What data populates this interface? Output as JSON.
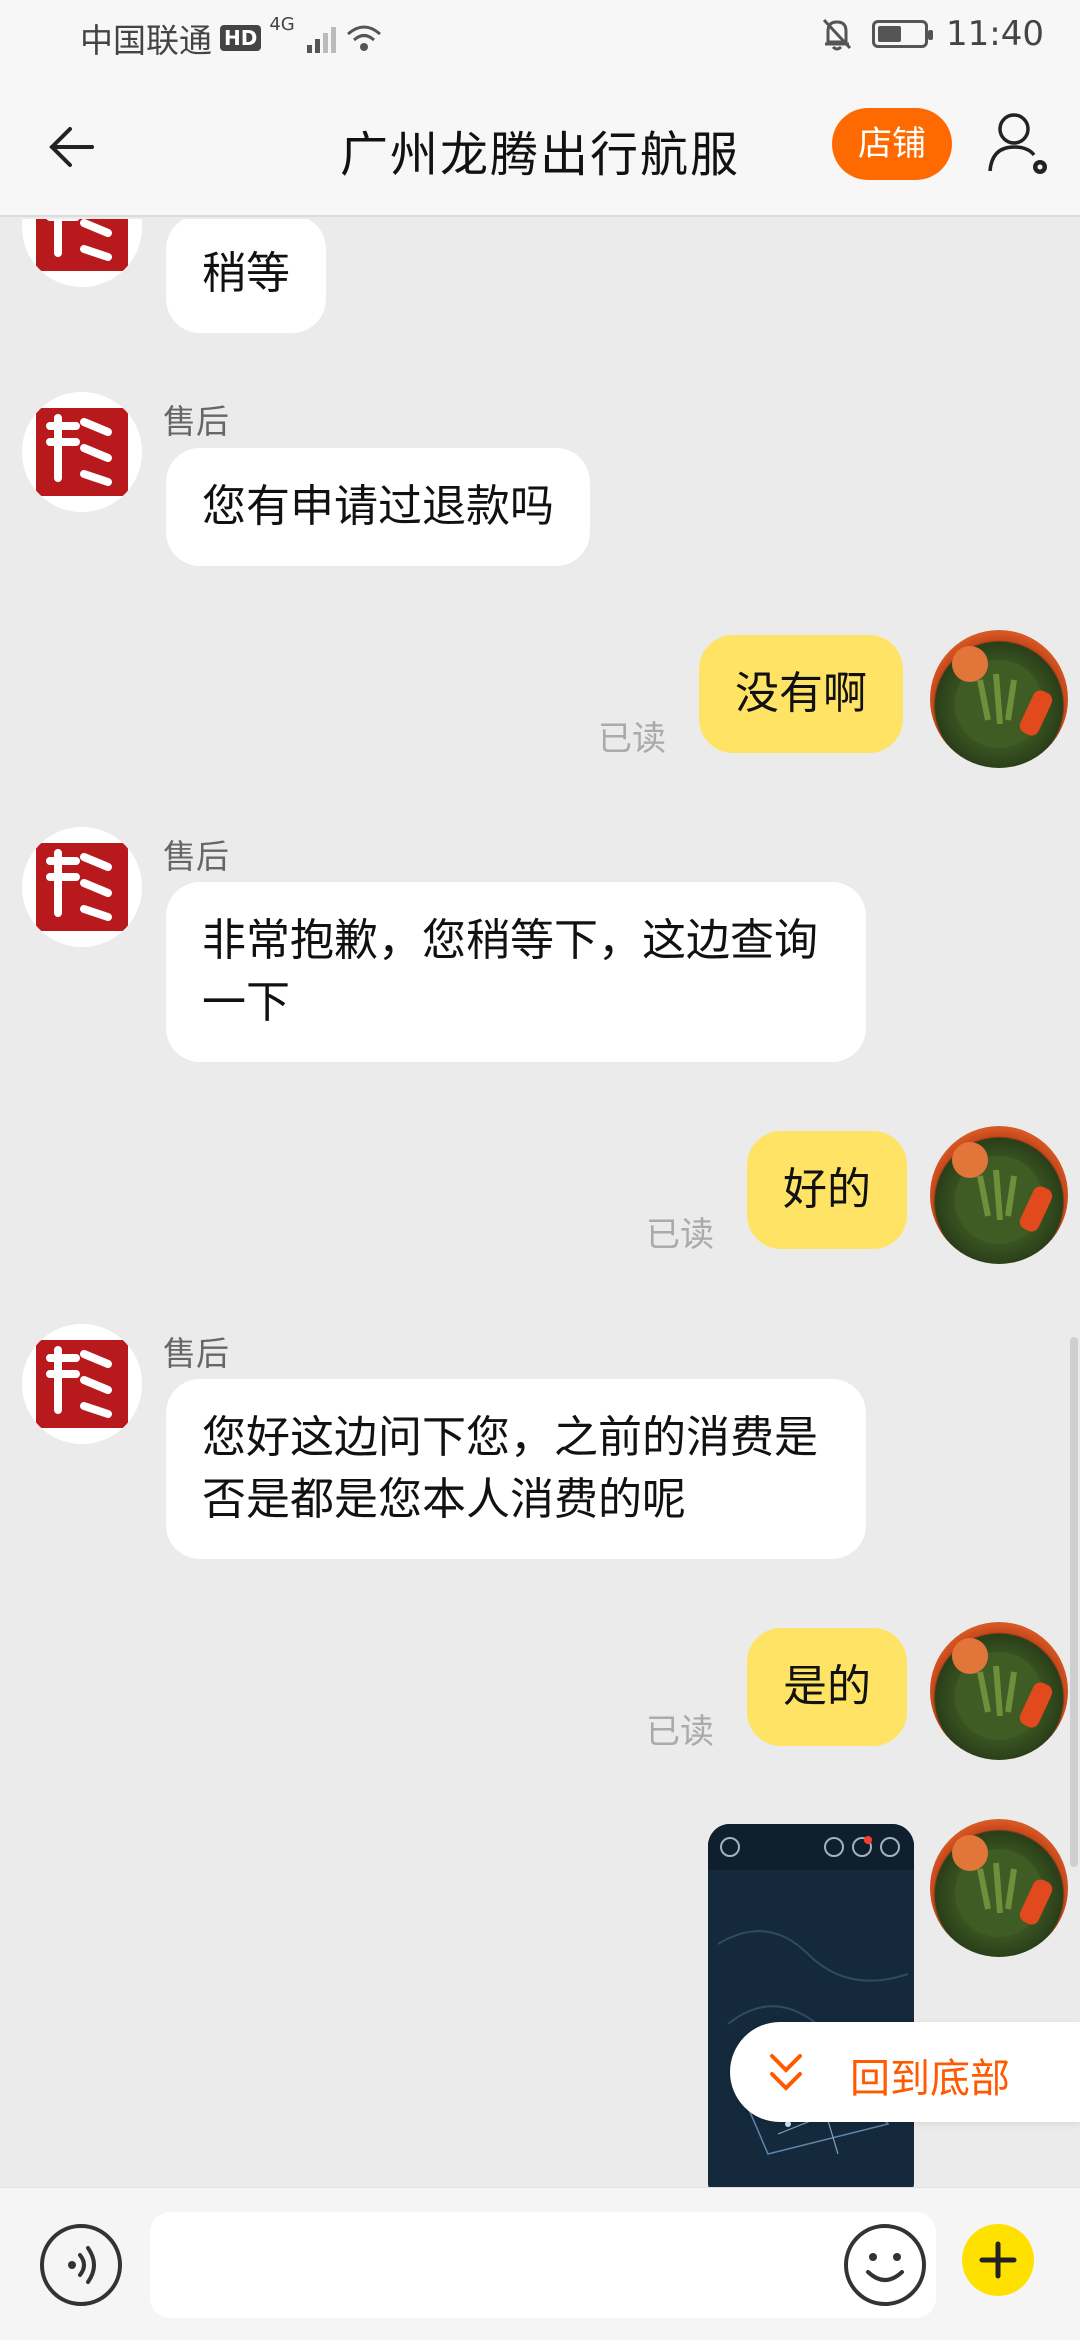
{
  "status": {
    "carrier": "中国联通",
    "hd": "HD",
    "network": "4G",
    "time": "11:40"
  },
  "header": {
    "title": "广州龙腾出行航服",
    "shop_label": "店铺"
  },
  "messages": [
    {
      "side": "shop",
      "sender": "",
      "text": "稍等"
    },
    {
      "side": "shop",
      "sender": "售后",
      "text": "您有申请过退款吗"
    },
    {
      "side": "me",
      "text": "没有啊",
      "status": "已读"
    },
    {
      "side": "shop",
      "sender": "售后",
      "text": "非常抱歉，您稍等下，这边查询一下"
    },
    {
      "side": "me",
      "text": "好的",
      "status": "已读"
    },
    {
      "side": "shop",
      "sender": "售后",
      "text": "您好这边问下您，之前的消费是否是都是您本人消费的呢"
    },
    {
      "side": "me",
      "text": "是的",
      "status": "已读"
    },
    {
      "side": "me",
      "type": "image",
      "text": ""
    }
  ],
  "jump": {
    "label": "回到底部"
  },
  "input": {
    "placeholder": ""
  },
  "colors": {
    "accent": "#ff6a00",
    "my_bubble": "#ffe365",
    "background": "#ebebeb"
  }
}
